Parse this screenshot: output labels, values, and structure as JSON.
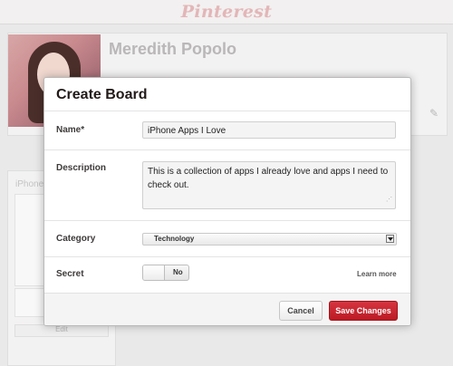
{
  "header": {
    "logo_text": "Pinterest"
  },
  "profile": {
    "name": "Meredith Popolo"
  },
  "board_panel": {
    "title": "iPhone",
    "edit_label": "Edit"
  },
  "dialog": {
    "title": "Create Board",
    "name_label": "Name*",
    "name_value": "iPhone Apps I Love",
    "description_label": "Description",
    "description_value": "This is a collection of apps I already love and apps I need to check out.",
    "category_label": "Category",
    "category_value": "Technology",
    "secret_label": "Secret",
    "secret_toggle_value": "No",
    "learn_more": "Learn more",
    "cancel_label": "Cancel",
    "save_label": "Save Changes"
  },
  "colors": {
    "brand": "#c8232c",
    "save_button": "#c8232c",
    "overlay": "#e9e9e9"
  },
  "icons": [
    "pencil-icon",
    "chevron-down-icon",
    "resize-grip-icon"
  ]
}
